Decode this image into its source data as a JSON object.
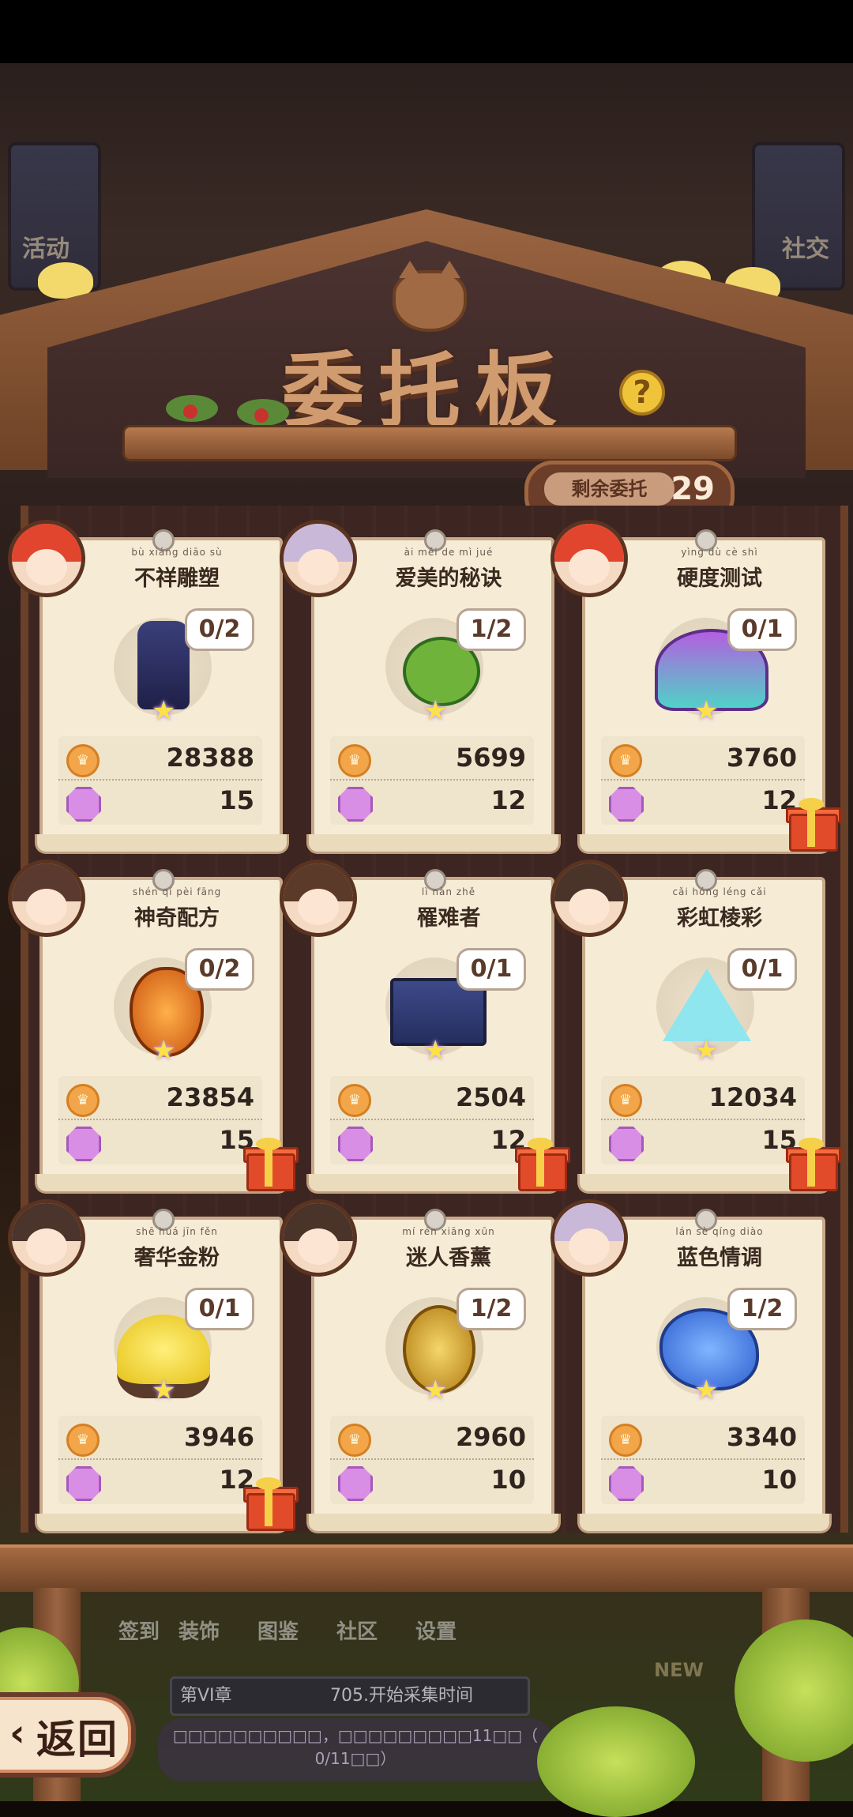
{
  "header": {
    "title": "委托板",
    "remaining_label": "剩余委托",
    "remaining_count": "29"
  },
  "background": {
    "left_label": "活动",
    "right_label": "社交",
    "nav_items": [
      "签到",
      "装饰",
      "图鉴",
      "社区",
      "设置"
    ],
    "chapter": "第VI章",
    "chapter_task": "705.开始采集时间",
    "chapter_desc_line1": "□□□□□□□□□□，□□□□□□□□□11□□（",
    "chapter_desc_line2": "0/11□□）",
    "new_tag": "NEW"
  },
  "cards": [
    {
      "pinyin": "bù xiáng diāo sù",
      "title": "不祥雕塑",
      "progress": "0/2",
      "gold": "28388",
      "gems": "15",
      "gift": false,
      "avatar_color": "#e2452e",
      "item": "statue"
    },
    {
      "pinyin": "ài měi de mì jué",
      "title": "爱美的秘诀",
      "progress": "1/2",
      "gold": "5699",
      "gems": "12",
      "gift": false,
      "avatar_color": "#c9b8d8",
      "item": "lotus"
    },
    {
      "pinyin": "yìng dù cè shì",
      "title": "硬度测试",
      "progress": "0/1",
      "gold": "3760",
      "gems": "12",
      "gift": true,
      "avatar_color": "#e2452e",
      "item": "shell"
    },
    {
      "pinyin": "shén qí pèi fāng",
      "title": "神奇配方",
      "progress": "0/2",
      "gold": "23854",
      "gems": "15",
      "gift": true,
      "avatar_color": "#5a3a2e",
      "item": "pouch"
    },
    {
      "pinyin": "lì nàn zhě",
      "title": "罹难者",
      "progress": "0/1",
      "gold": "2504",
      "gems": "12",
      "gift": true,
      "avatar_color": "#5c3a2a",
      "item": "chest"
    },
    {
      "pinyin": "cǎi hóng léng cǎi",
      "title": "彩虹棱彩",
      "progress": "0/1",
      "gold": "12034",
      "gems": "15",
      "gift": true,
      "avatar_color": "#4a3328",
      "item": "prism"
    },
    {
      "pinyin": "shē huá jīn fěn",
      "title": "奢华金粉",
      "progress": "0/1",
      "gold": "3946",
      "gems": "12",
      "gift": true,
      "avatar_color": "#4a342b",
      "item": "gold"
    },
    {
      "pinyin": "mí rén xiāng xūn",
      "title": "迷人香薰",
      "progress": "1/2",
      "gold": "2960",
      "gems": "10",
      "gift": false,
      "avatar_color": "#4a3328",
      "item": "incense"
    },
    {
      "pinyin": "lán sè qíng diào",
      "title": "蓝色情调",
      "progress": "1/2",
      "gold": "3340",
      "gems": "10",
      "gift": false,
      "avatar_color": "#c9b8d8",
      "item": "blueplant"
    }
  ],
  "back_button": {
    "label": "返回"
  },
  "colors": {
    "gold_coin": "#f3a54a",
    "gem": "#d98ee6",
    "card_bg": "#f6ecd6",
    "gift": "#e14b2a"
  }
}
